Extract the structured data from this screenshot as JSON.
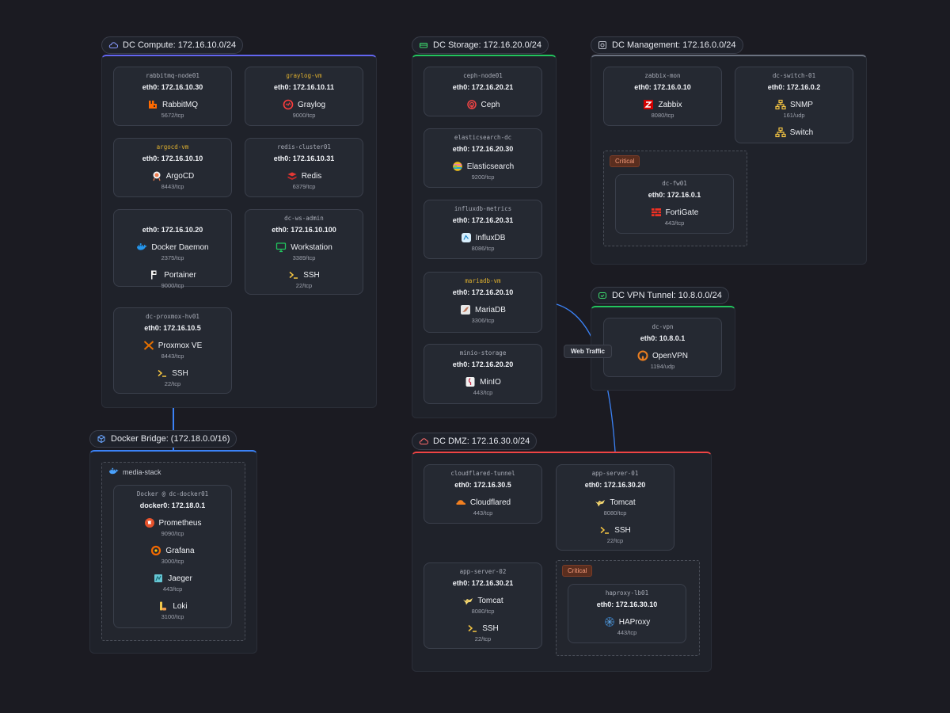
{
  "colors": {
    "compute": "#6366f1",
    "storage": "#22c55e",
    "management": "#6b7280",
    "vpn": "#22c55e",
    "dmz": "#ef4444",
    "bridge": "#3b82f6",
    "edge": "#3b82f6",
    "warn_host": "#e0b12f"
  },
  "groups": {
    "compute": {
      "label": "DC Compute: 172.16.10.0/24",
      "icon": "cloud-icon"
    },
    "storage": {
      "label": "DC Storage: 172.16.20.0/24",
      "icon": "storage-icon"
    },
    "management": {
      "label": "DC Management: 172.16.0.0/24",
      "icon": "management-icon"
    },
    "vpn": {
      "label": "DC VPN Tunnel: 10.8.0.0/24",
      "icon": "shield-icon"
    },
    "dmz": {
      "label": "DC DMZ: 172.16.30.0/24",
      "icon": "cloud-icon"
    },
    "bridge": {
      "label": "Docker Bridge: (172.18.0.0/16)",
      "icon": "cube-icon"
    }
  },
  "subgroups": {
    "mgmt_critical": {
      "badge": "Critical"
    },
    "dmz_critical": {
      "badge": "Critical"
    },
    "media_stack": {
      "label": "media-stack",
      "icon": "docker-icon"
    }
  },
  "nodes": {
    "rabbitmq": {
      "hostname": "rabbitmq-node01",
      "ip": "eth0: 172.16.10.30",
      "services": [
        {
          "name": "RabbitMQ",
          "icon": "rabbitmq-icon",
          "port": "5672/tcp"
        }
      ]
    },
    "graylog": {
      "hostname": "graylog-vm",
      "ip": "eth0: 172.16.10.11",
      "services": [
        {
          "name": "Graylog",
          "icon": "graylog-icon",
          "port": "9000/tcp"
        }
      ]
    },
    "argocd": {
      "hostname": "argocd-vm",
      "ip": "eth0: 172.16.10.10",
      "services": [
        {
          "name": "ArgoCD",
          "icon": "argocd-icon",
          "port": "8443/tcp"
        }
      ]
    },
    "redis": {
      "hostname": "redis-cluster01",
      "ip": "eth0: 172.16.10.31",
      "services": [
        {
          "name": "Redis",
          "icon": "redis-icon",
          "port": "6379/tcp"
        }
      ]
    },
    "docker_host": {
      "hostname": "",
      "ip": "eth0: 172.16.10.20",
      "services": [
        {
          "name": "Docker Daemon",
          "icon": "docker-icon",
          "port": "2375/tcp"
        },
        {
          "name": "Portainer",
          "icon": "portainer-icon",
          "port": "9000/tcp"
        }
      ]
    },
    "ws_admin": {
      "hostname": "dc-ws-admin",
      "ip": "eth0: 172.16.10.100",
      "services": [
        {
          "name": "Workstation",
          "icon": "monitor-icon",
          "port": "3389/tcp"
        },
        {
          "name": "SSH",
          "icon": "terminal-icon",
          "port": "22/tcp"
        }
      ]
    },
    "proxmox": {
      "hostname": "dc-proxmox-hv01",
      "ip": "eth0: 172.16.10.5",
      "services": [
        {
          "name": "Proxmox VE",
          "icon": "proxmox-icon",
          "port": "8443/tcp"
        },
        {
          "name": "SSH",
          "icon": "terminal-icon",
          "port": "22/tcp"
        }
      ]
    },
    "ceph": {
      "hostname": "ceph-node01",
      "ip": "eth0: 172.16.20.21",
      "services": [
        {
          "name": "Ceph",
          "icon": "ceph-icon",
          "port": ""
        }
      ]
    },
    "elastic": {
      "hostname": "elasticsearch-dc",
      "ip": "eth0: 172.16.20.30",
      "services": [
        {
          "name": "Elasticsearch",
          "icon": "elasticsearch-icon",
          "port": "9200/tcp"
        }
      ]
    },
    "influx": {
      "hostname": "influxdb-metrics",
      "ip": "eth0: 172.16.20.31",
      "services": [
        {
          "name": "InfluxDB",
          "icon": "influxdb-icon",
          "port": "8086/tcp"
        }
      ]
    },
    "mariadb": {
      "hostname": "mariadb-vm",
      "ip": "eth0: 172.16.20.10",
      "services": [
        {
          "name": "MariaDB",
          "icon": "mariadb-icon",
          "port": "3306/tcp"
        }
      ]
    },
    "minio": {
      "hostname": "minio-storage",
      "ip": "eth0: 172.16.20.20",
      "services": [
        {
          "name": "MinIO",
          "icon": "minio-icon",
          "port": "443/tcp"
        }
      ]
    },
    "zabbix": {
      "hostname": "zabbix-mon",
      "ip": "eth0: 172.16.0.10",
      "services": [
        {
          "name": "Zabbix",
          "icon": "zabbix-icon",
          "port": "8080/tcp"
        }
      ]
    },
    "switch": {
      "hostname": "dc-switch-01",
      "ip": "eth0: 172.16.0.2",
      "services": [
        {
          "name": "SNMP",
          "icon": "network-icon",
          "port": "161/udp"
        },
        {
          "name": "Switch",
          "icon": "network-icon",
          "port": ""
        }
      ]
    },
    "fortigate": {
      "hostname": "dc-fw01",
      "ip": "eth0: 172.16.0.1",
      "services": [
        {
          "name": "FortiGate",
          "icon": "firewall-icon",
          "port": "443/tcp"
        }
      ]
    },
    "vpn": {
      "hostname": "dc-vpn",
      "ip": "eth0: 10.8.0.1",
      "services": [
        {
          "name": "OpenVPN",
          "icon": "openvpn-icon",
          "port": "1194/udp"
        }
      ]
    },
    "cloudflared": {
      "hostname": "cloudflared-tunnel",
      "ip": "eth0: 172.16.30.5",
      "services": [
        {
          "name": "Cloudflared",
          "icon": "cloudflare-icon",
          "port": "443/tcp"
        }
      ]
    },
    "app1": {
      "hostname": "app-server-01",
      "ip": "eth0: 172.16.30.20",
      "services": [
        {
          "name": "Tomcat",
          "icon": "tomcat-icon",
          "port": "8080/tcp"
        },
        {
          "name": "SSH",
          "icon": "terminal-icon",
          "port": "22/tcp"
        }
      ]
    },
    "app2": {
      "hostname": "app-server-02",
      "ip": "eth0: 172.16.30.21",
      "services": [
        {
          "name": "Tomcat",
          "icon": "tomcat-icon",
          "port": "8080/tcp"
        },
        {
          "name": "SSH",
          "icon": "terminal-icon",
          "port": "22/tcp"
        }
      ]
    },
    "haproxy": {
      "hostname": "haproxy-lb01",
      "ip": "eth0: 172.16.30.10",
      "services": [
        {
          "name": "HAProxy",
          "icon": "haproxy-icon",
          "port": "443/tcp"
        }
      ]
    },
    "docker_container": {
      "hostname": "Docker @ dc-docker01",
      "ip": "docker0: 172.18.0.1",
      "services": [
        {
          "name": "Prometheus",
          "icon": "prometheus-icon",
          "port": "9090/tcp"
        },
        {
          "name": "Grafana",
          "icon": "grafana-icon",
          "port": "3000/tcp"
        },
        {
          "name": "Jaeger",
          "icon": "jaeger-icon",
          "port": "443/tcp"
        },
        {
          "name": "Loki",
          "icon": "loki-icon",
          "port": "3100/tcp"
        }
      ]
    }
  },
  "edges": {
    "web_traffic": {
      "label": "Web Traffic"
    }
  }
}
